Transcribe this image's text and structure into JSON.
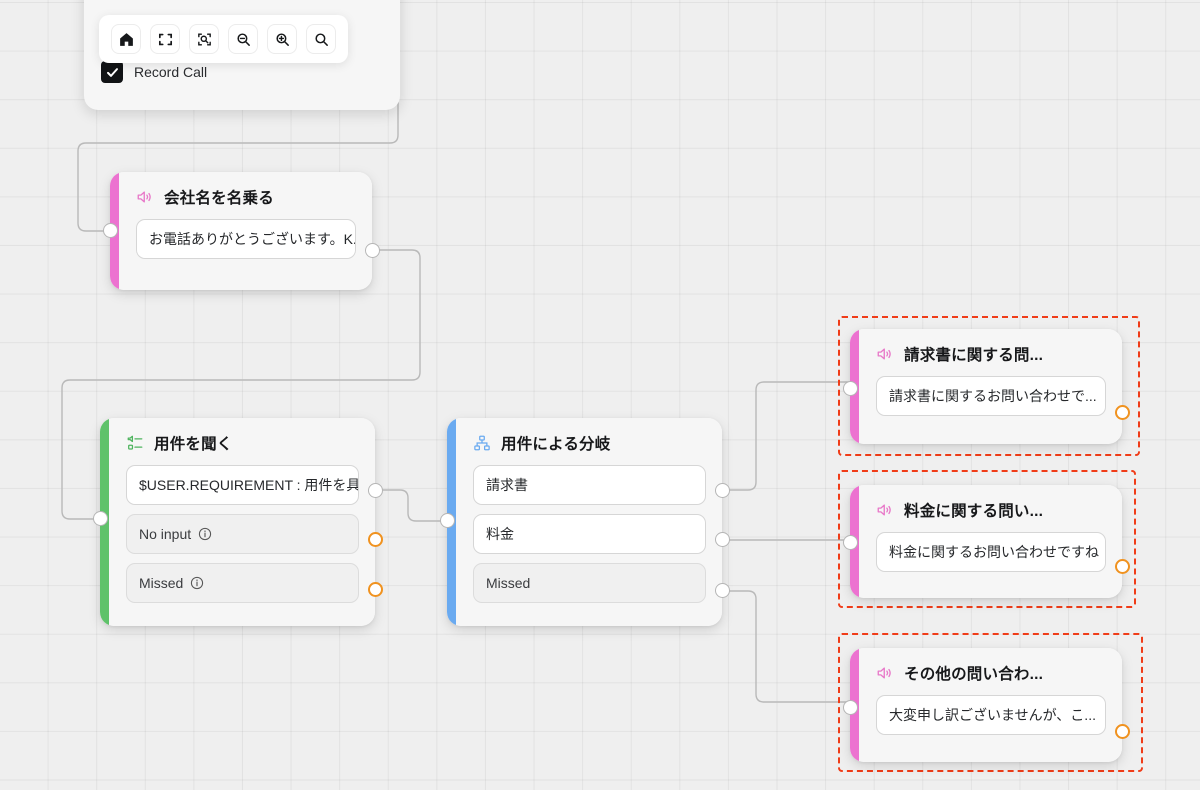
{
  "canvas": {
    "grid_color": "#e5e5e5",
    "background": "#efefef"
  },
  "toolbar": {
    "name": "canvas-toolbar",
    "buttons": [
      {
        "name": "home-icon",
        "label": "Home"
      },
      {
        "name": "fit-view-icon",
        "label": "Fit view"
      },
      {
        "name": "zoom-to-selection-icon",
        "label": "Zoom to selection"
      },
      {
        "name": "zoom-out-icon",
        "label": "Zoom out"
      },
      {
        "name": "zoom-in-icon",
        "label": "Zoom in"
      },
      {
        "name": "search-icon",
        "label": "Search"
      }
    ]
  },
  "record_call": {
    "label": "Record Call",
    "checked": true
  },
  "colors": {
    "accent_pink": "#ec72d0",
    "accent_green": "#5fc26a",
    "accent_blue": "#6aaaf0",
    "port_orange": "#f0921f",
    "highlight_red": "#f03c18",
    "edge_gray": "#b9b9b9"
  },
  "nodes": [
    {
      "id": "greeting",
      "title": "会社名を名乗る",
      "icon": "speaker-icon",
      "accent": "pink",
      "highlighted": false,
      "fields": [
        {
          "text": "お電話ありがとうございます。K...",
          "muted": false,
          "info": false,
          "port": "plain"
        }
      ]
    },
    {
      "id": "ask-requirement",
      "title": "用件を聞く",
      "icon": "input-prompt-icon",
      "accent": "green",
      "highlighted": false,
      "fields": [
        {
          "text": "$USER.REQUIREMENT : 用件を具体...",
          "muted": false,
          "info": false,
          "port": "plain"
        },
        {
          "text": "No input",
          "muted": true,
          "info": true,
          "port": "orange"
        },
        {
          "text": "Missed",
          "muted": true,
          "info": true,
          "port": "orange"
        }
      ]
    },
    {
      "id": "branch-by-requirement",
      "title": "用件による分岐",
      "icon": "branch-icon",
      "accent": "blue",
      "highlighted": false,
      "fields": [
        {
          "text": "請求書",
          "muted": false,
          "info": false,
          "port": "plain"
        },
        {
          "text": "料金",
          "muted": false,
          "info": false,
          "port": "plain"
        },
        {
          "text": "Missed",
          "muted": true,
          "info": false,
          "port": "plain"
        }
      ]
    },
    {
      "id": "invoice-reply",
      "title": "請求書に関する問...",
      "icon": "speaker-icon",
      "accent": "pink",
      "highlighted": true,
      "fields": [
        {
          "text": "請求書に関するお問い合わせで...",
          "muted": false,
          "info": false,
          "port": "orange"
        }
      ]
    },
    {
      "id": "pricing-reply",
      "title": "料金に関する問い...",
      "icon": "speaker-icon",
      "accent": "pink",
      "highlighted": true,
      "fields": [
        {
          "text": "料金に関するお問い合わせですね",
          "muted": false,
          "info": false,
          "port": "orange"
        }
      ]
    },
    {
      "id": "other-reply",
      "title": "その他の問い合わ...",
      "icon": "speaker-icon",
      "accent": "pink",
      "highlighted": true,
      "fields": [
        {
          "text": "大変申し訳ございませんが、こ...",
          "muted": false,
          "info": false,
          "port": "orange"
        }
      ]
    }
  ]
}
